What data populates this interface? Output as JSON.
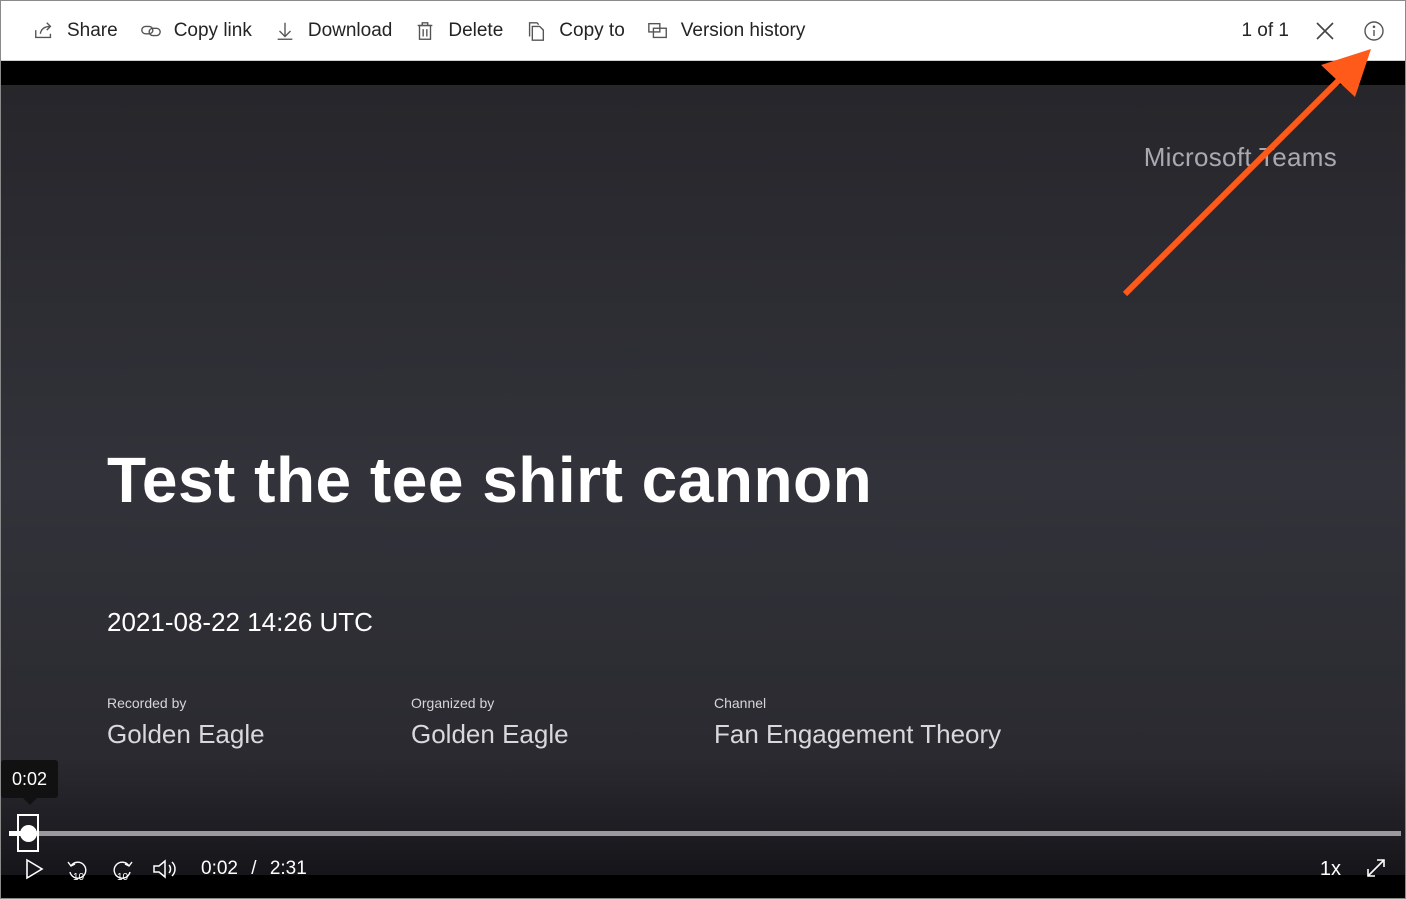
{
  "toolbar": {
    "share_label": "Share",
    "copy_link_label": "Copy link",
    "download_label": "Download",
    "delete_label": "Delete",
    "copy_to_label": "Copy to",
    "version_history_label": "Version history",
    "counter": "1 of 1",
    "icons": [
      "share-icon",
      "link-icon",
      "download-icon",
      "trash-icon",
      "copy-icon",
      "version-history-icon",
      "close-icon",
      "info-icon"
    ]
  },
  "slide": {
    "brand": "Microsoft Teams",
    "title": "Test the tee shirt cannon",
    "datetime": "2021-08-22 14:26 UTC",
    "recorded_by_label": "Recorded by",
    "recorded_by": "Golden Eagle",
    "organized_by_label": "Organized by",
    "organized_by": "Golden Eagle",
    "channel_label": "Channel",
    "channel": "Fan Engagement Theory"
  },
  "player": {
    "tooltip_time": "0:02",
    "current_time": "0:02",
    "separator": "/",
    "duration": "2:31",
    "progress_fraction": 0.013,
    "playback_rate": "1x",
    "rewind_seconds": "10",
    "forward_seconds": "10"
  },
  "colors": {
    "annotation_arrow": "#ff5a1a",
    "toolbar_bg": "#ffffff",
    "video_bg": "#2c2c33"
  }
}
